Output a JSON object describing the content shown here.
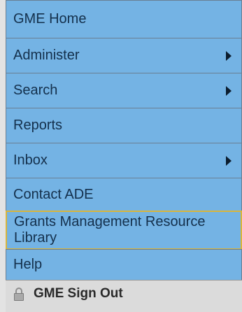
{
  "menu": {
    "items": [
      {
        "label": "GME Home",
        "has_submenu": false
      },
      {
        "label": "Administer",
        "has_submenu": true
      },
      {
        "label": "Search",
        "has_submenu": true
      },
      {
        "label": "Reports",
        "has_submenu": false
      },
      {
        "label": "Inbox",
        "has_submenu": true
      },
      {
        "label": "Contact ADE",
        "has_submenu": false
      },
      {
        "label": "Grants Management Resource Library",
        "has_submenu": false
      },
      {
        "label": "Help",
        "has_submenu": false
      }
    ],
    "signout_label": "GME Sign Out",
    "icons": {
      "submenu_arrow": "triangle-right-icon",
      "signout": "lock-icon"
    },
    "colors": {
      "item_background": "#74b3e4",
      "highlight_border": "#d9b53c",
      "signout_background": "#dbdbdb"
    }
  }
}
